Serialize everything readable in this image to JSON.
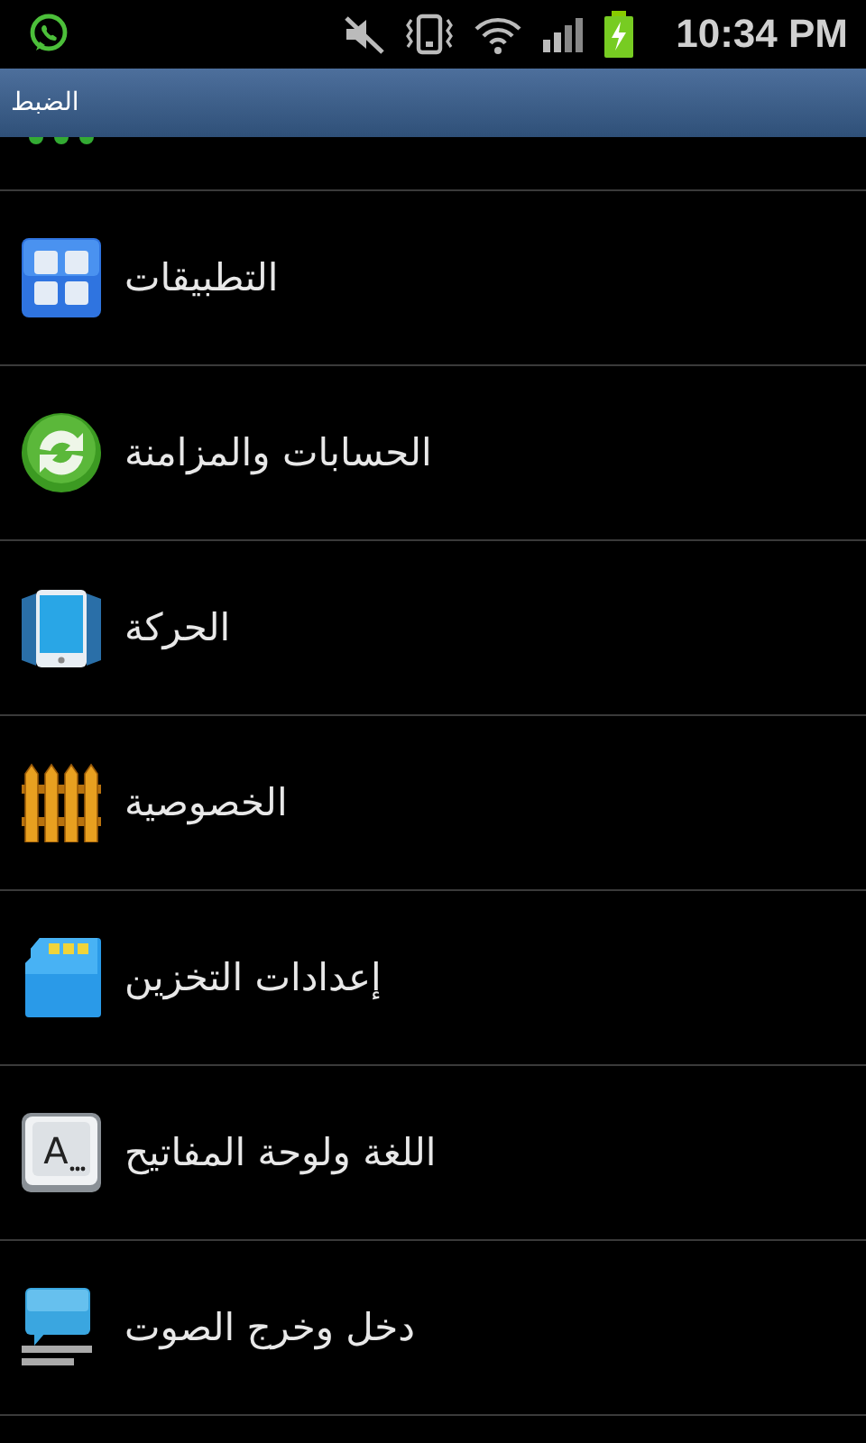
{
  "status_bar": {
    "time": "10:34 PM",
    "battery_charging": true
  },
  "title_bar": {
    "title": "الضبط"
  },
  "partial_row": {
    "kind": "dots"
  },
  "items": [
    {
      "label": "التطبيقات",
      "kind": "apps"
    },
    {
      "label": "الحسابات والمزامنة",
      "kind": "sync"
    },
    {
      "label": "الحركة",
      "kind": "motion"
    },
    {
      "label": "الخصوصية",
      "kind": "fence"
    },
    {
      "label": "إعدادات التخزين",
      "kind": "storage"
    },
    {
      "label": "اللغة ولوحة المفاتيح",
      "kind": "keyboard",
      "icon_text": "A"
    },
    {
      "label": "دخل وخرج الصوت",
      "kind": "voice"
    }
  ]
}
